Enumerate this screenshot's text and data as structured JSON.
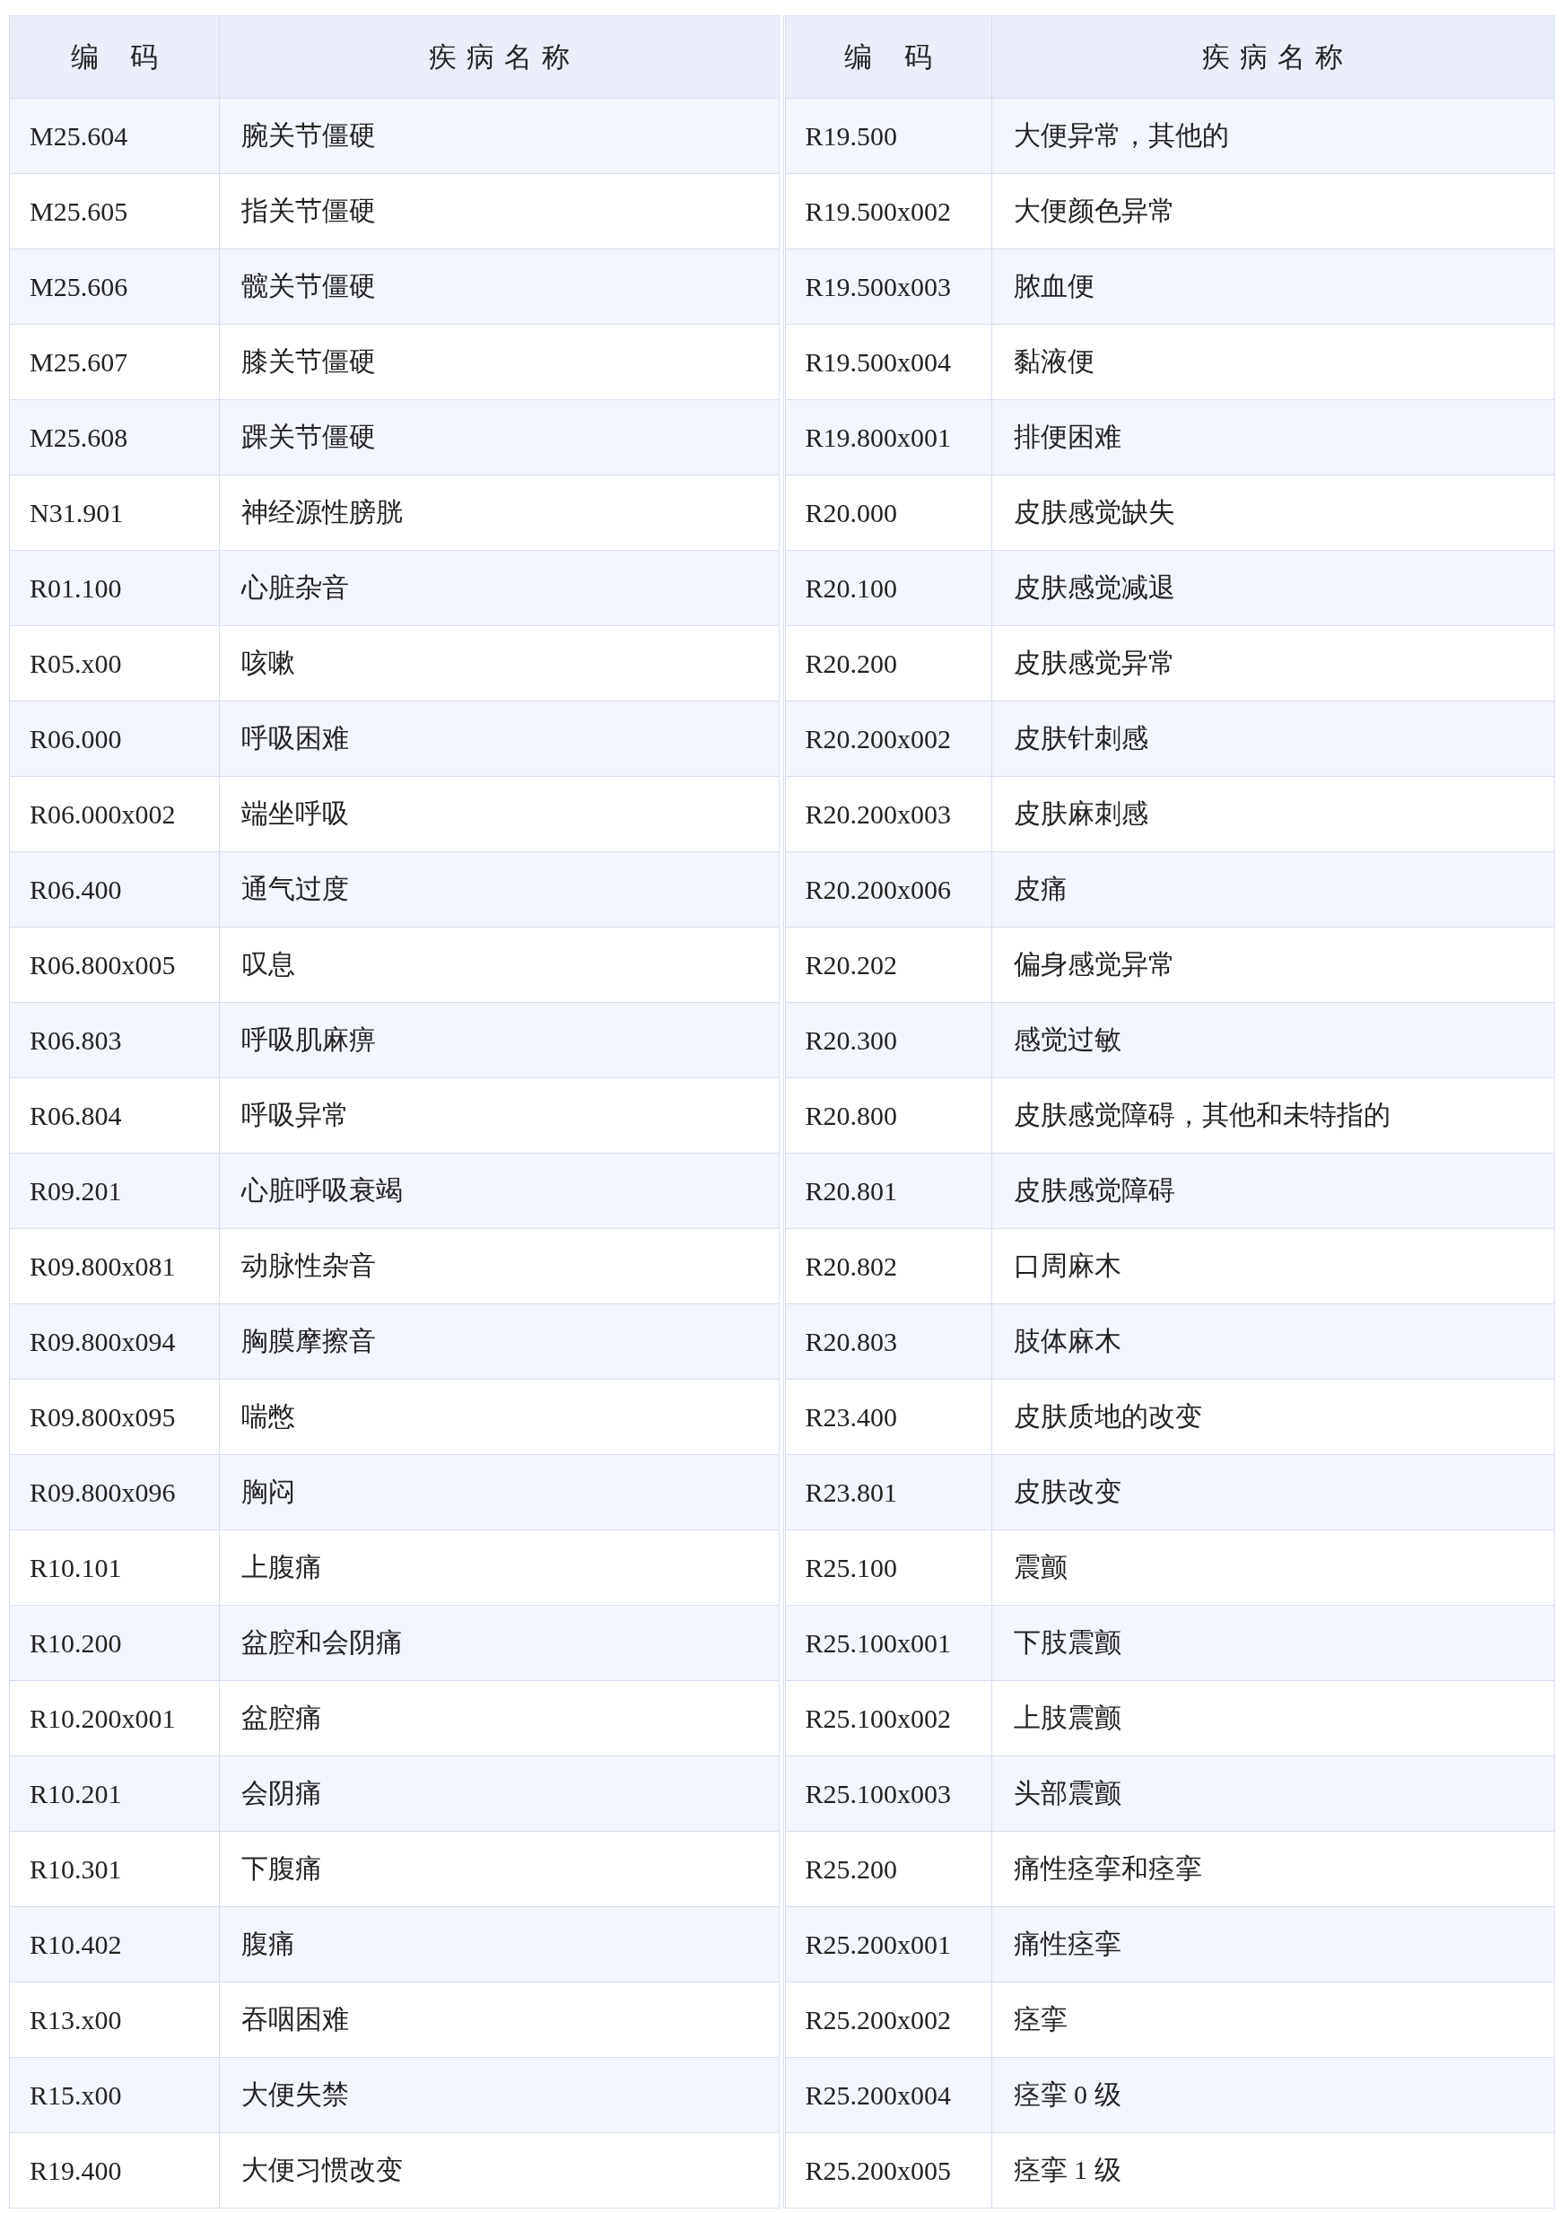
{
  "tables": [
    {
      "columns": [
        "编 码",
        "疾 病 名 称"
      ],
      "rows": [
        [
          "M25.604",
          "腕关节僵硬"
        ],
        [
          "M25.605",
          "指关节僵硬"
        ],
        [
          "M25.606",
          "髋关节僵硬"
        ],
        [
          "M25.607",
          "膝关节僵硬"
        ],
        [
          "M25.608",
          "踝关节僵硬"
        ],
        [
          "N31.901",
          "神经源性膀胱"
        ],
        [
          "R01.100",
          "心脏杂音"
        ],
        [
          "R05.x00",
          "咳嗽"
        ],
        [
          "R06.000",
          "呼吸困难"
        ],
        [
          "R06.000x002",
          "端坐呼吸"
        ],
        [
          "R06.400",
          "通气过度"
        ],
        [
          "R06.800x005",
          "叹息"
        ],
        [
          "R06.803",
          "呼吸肌麻痹"
        ],
        [
          "R06.804",
          "呼吸异常"
        ],
        [
          "R09.201",
          "心脏呼吸衰竭"
        ],
        [
          "R09.800x081",
          "动脉性杂音"
        ],
        [
          "R09.800x094",
          "胸膜摩擦音"
        ],
        [
          "R09.800x095",
          "喘憋"
        ],
        [
          "R09.800x096",
          "胸闷"
        ],
        [
          "R10.101",
          "上腹痛"
        ],
        [
          "R10.200",
          "盆腔和会阴痛"
        ],
        [
          "R10.200x001",
          "盆腔痛"
        ],
        [
          "R10.201",
          "会阴痛"
        ],
        [
          "R10.301",
          "下腹痛"
        ],
        [
          "R10.402",
          "腹痛"
        ],
        [
          "R13.x00",
          "吞咽困难"
        ],
        [
          "R15.x00",
          "大便失禁"
        ],
        [
          "R19.400",
          "大便习惯改变"
        ]
      ]
    },
    {
      "columns": [
        "编 码",
        "疾 病 名 称"
      ],
      "rows": [
        [
          "R19.500",
          "大便异常，其他的"
        ],
        [
          "R19.500x002",
          "大便颜色异常"
        ],
        [
          "R19.500x003",
          "脓血便"
        ],
        [
          "R19.500x004",
          "黏液便"
        ],
        [
          "R19.800x001",
          "排便困难"
        ],
        [
          "R20.000",
          "皮肤感觉缺失"
        ],
        [
          "R20.100",
          "皮肤感觉减退"
        ],
        [
          "R20.200",
          "皮肤感觉异常"
        ],
        [
          "R20.200x002",
          "皮肤针刺感"
        ],
        [
          "R20.200x003",
          "皮肤麻刺感"
        ],
        [
          "R20.200x006",
          "皮痛"
        ],
        [
          "R20.202",
          "偏身感觉异常"
        ],
        [
          "R20.300",
          "感觉过敏"
        ],
        [
          "R20.800",
          "皮肤感觉障碍，其他和未特指的"
        ],
        [
          "R20.801",
          "皮肤感觉障碍"
        ],
        [
          "R20.802",
          "口周麻木"
        ],
        [
          "R20.803",
          "肢体麻木"
        ],
        [
          "R23.400",
          "皮肤质地的改变"
        ],
        [
          "R23.801",
          "皮肤改变"
        ],
        [
          "R25.100",
          "震颤"
        ],
        [
          "R25.100x001",
          "下肢震颤"
        ],
        [
          "R25.100x002",
          "上肢震颤"
        ],
        [
          "R25.100x003",
          "头部震颤"
        ],
        [
          "R25.200",
          "痛性痉挛和痉挛"
        ],
        [
          "R25.200x001",
          "痛性痉挛"
        ],
        [
          "R25.200x002",
          "痉挛"
        ],
        [
          "R25.200x004",
          "痉挛 0 级"
        ],
        [
          "R25.200x005",
          "痉挛 1 级"
        ]
      ]
    }
  ]
}
